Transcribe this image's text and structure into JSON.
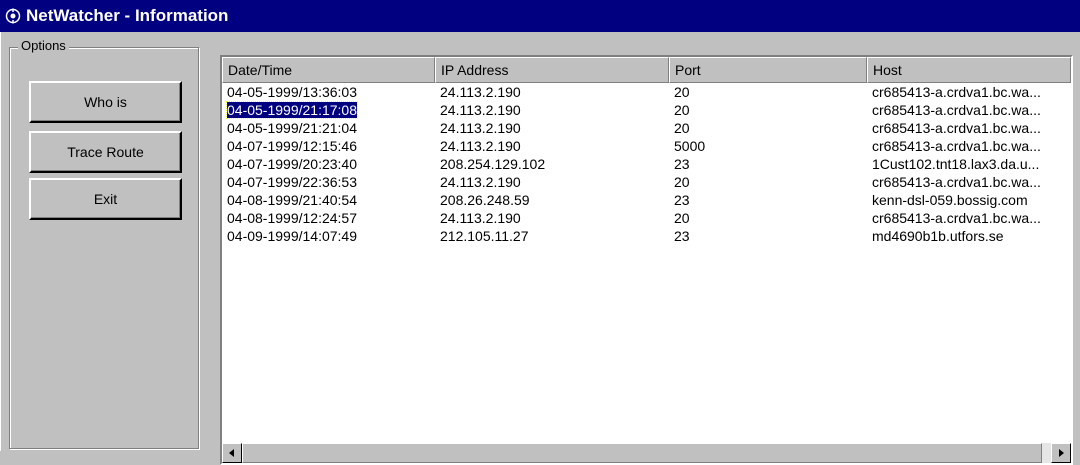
{
  "window": {
    "title": "NetWatcher - Information",
    "icon": "netwatcher-app-icon"
  },
  "options": {
    "legend": "Options",
    "buttons": [
      {
        "label": "Who is"
      },
      {
        "label": "Trace Route"
      },
      {
        "label": "Exit"
      }
    ]
  },
  "table": {
    "columns": [
      "Date/Time",
      "IP Address",
      "Port",
      "Host"
    ],
    "rows": [
      [
        "04-05-1999/13:36:03",
        "24.113.2.190",
        "20",
        "cr685413-a.crdva1.bc.wa..."
      ],
      [
        "04-05-1999/21:17:08",
        "24.113.2.190",
        "20",
        "cr685413-a.crdva1.bc.wa..."
      ],
      [
        "04-05-1999/21:21:04",
        "24.113.2.190",
        "20",
        "cr685413-a.crdva1.bc.wa..."
      ],
      [
        "04-07-1999/12:15:46",
        "24.113.2.190",
        "5000",
        "cr685413-a.crdva1.bc.wa..."
      ],
      [
        "04-07-1999/20:23:40",
        "208.254.129.102",
        "23",
        "1Cust102.tnt18.lax3.da.u..."
      ],
      [
        "04-07-1999/22:36:53",
        "24.113.2.190",
        "20",
        "cr685413-a.crdva1.bc.wa..."
      ],
      [
        "04-08-1999/21:40:54",
        "208.26.248.59",
        "23",
        "kenn-dsl-059.bossig.com"
      ],
      [
        "04-08-1999/12:24:57",
        "24.113.2.190",
        "20",
        "cr685413-a.crdva1.bc.wa..."
      ],
      [
        "04-09-1999/14:07:49",
        "212.105.11.27",
        "23",
        "md4690b1b.utfors.se"
      ]
    ],
    "selected_row": 1
  },
  "scrollbar": {
    "left_icon": "scroll-left-arrow-icon",
    "right_icon": "scroll-right-arrow-icon"
  },
  "colors": {
    "titlebar": "#000080",
    "selection": "#000080",
    "face": "#c0c0c0"
  }
}
